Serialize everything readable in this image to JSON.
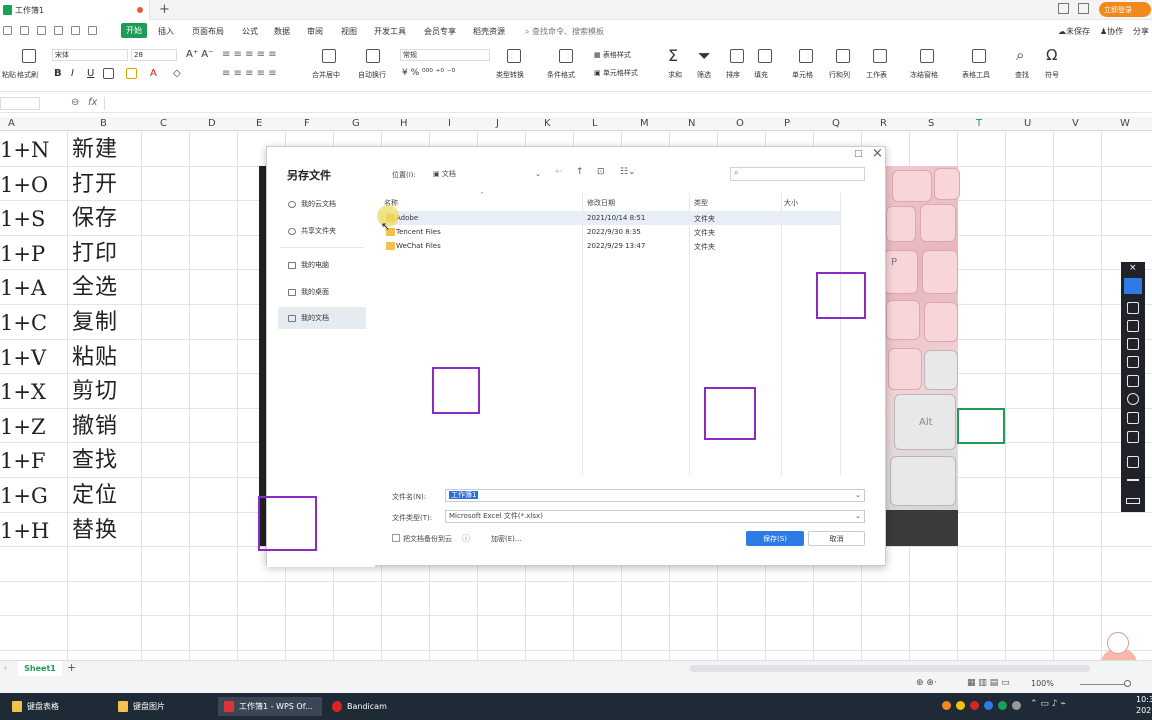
{
  "titlebar": {
    "doc_tab": "工作簿1",
    "login_pill": "立即登录"
  },
  "menu": {
    "items": [
      "开始",
      "插入",
      "页面布局",
      "公式",
      "数据",
      "审阅",
      "视图",
      "开发工具",
      "会员专享",
      "稻壳资源"
    ],
    "search_hint": "查找命令、搜索模板",
    "right": [
      "未保存",
      "协作",
      "分享"
    ]
  },
  "ribbon": {
    "font_name": "宋体",
    "font_size": "28",
    "number_format": "常规",
    "labels": [
      "格式刷",
      "粘贴",
      "合并居中",
      "自动换行",
      "类型转换",
      "条件格式",
      "表格样式",
      "单元格样式",
      "求和",
      "筛选",
      "排序",
      "填充",
      "单元格",
      "行和列",
      "工作表",
      "冻结窗格",
      "表格工具",
      "查找",
      "符号"
    ]
  },
  "formula_bar": {
    "fx": "fx"
  },
  "columns": [
    "A",
    "B",
    "C",
    "D",
    "E",
    "F",
    "G",
    "H",
    "I",
    "J",
    "K",
    "L",
    "M",
    "N",
    "O",
    "P",
    "Q",
    "R",
    "S",
    "T",
    "U",
    "V",
    "W"
  ],
  "rows": [
    {
      "keys": "1+N",
      "label": "新建"
    },
    {
      "keys": "1+O",
      "label": "打开"
    },
    {
      "keys": "1+S",
      "label": "保存"
    },
    {
      "keys": "1+P",
      "label": "打印"
    },
    {
      "keys": "1+A",
      "label": "全选"
    },
    {
      "keys": "1+C",
      "label": "复制"
    },
    {
      "keys": "1+V",
      "label": "粘贴"
    },
    {
      "keys": "1+X",
      "label": "剪切"
    },
    {
      "keys": "1+Z",
      "label": "撤销"
    },
    {
      "keys": "1+F",
      "label": "查找"
    },
    {
      "keys": "1+G",
      "label": "定位"
    },
    {
      "keys": "1+H",
      "label": "替换"
    }
  ],
  "dialog": {
    "title": "另存文件",
    "sidebar": [
      "我的云文档",
      "共享文件夹",
      "我的电脑",
      "我的桌面",
      "我的文档"
    ],
    "location_label": "位置(I):",
    "location_value": "文档",
    "headers": {
      "name": "名称",
      "date": "修改日期",
      "type": "类型",
      "size": "大小"
    },
    "files": [
      {
        "name": "Adobe",
        "date": "2021/10/14 8:51",
        "type": "文件夹"
      },
      {
        "name": "Tencent Files",
        "date": "2022/9/30 8:35",
        "type": "文件夹"
      },
      {
        "name": "WeChat Files",
        "date": "2022/9/29 13:47",
        "type": "文件夹"
      }
    ],
    "filename_label": "文件名(N):",
    "filename_value": "工作簿1",
    "filetype_label": "文件类型(T):",
    "filetype_value": "Microsoft Excel 文件(*.xlsx)",
    "backup_label": "把文档备份到云",
    "encrypt_label": "加密(E)...",
    "save_label": "保存(S)",
    "cancel_label": "取消"
  },
  "photo_keys": [
    "P",
    "Alt"
  ],
  "sheet": {
    "tab": "Sheet1",
    "zoom": "100%"
  },
  "taskbar": {
    "items": [
      "键盘表格",
      "键盘图片",
      "工作簿1 - WPS Of...",
      "Bandicam"
    ],
    "time": "10:3",
    "date": "202"
  },
  "colors": {
    "accent": "#1e9c55",
    "purple": "#8a2bc6",
    "dialog_primary": "#2f7be5"
  }
}
